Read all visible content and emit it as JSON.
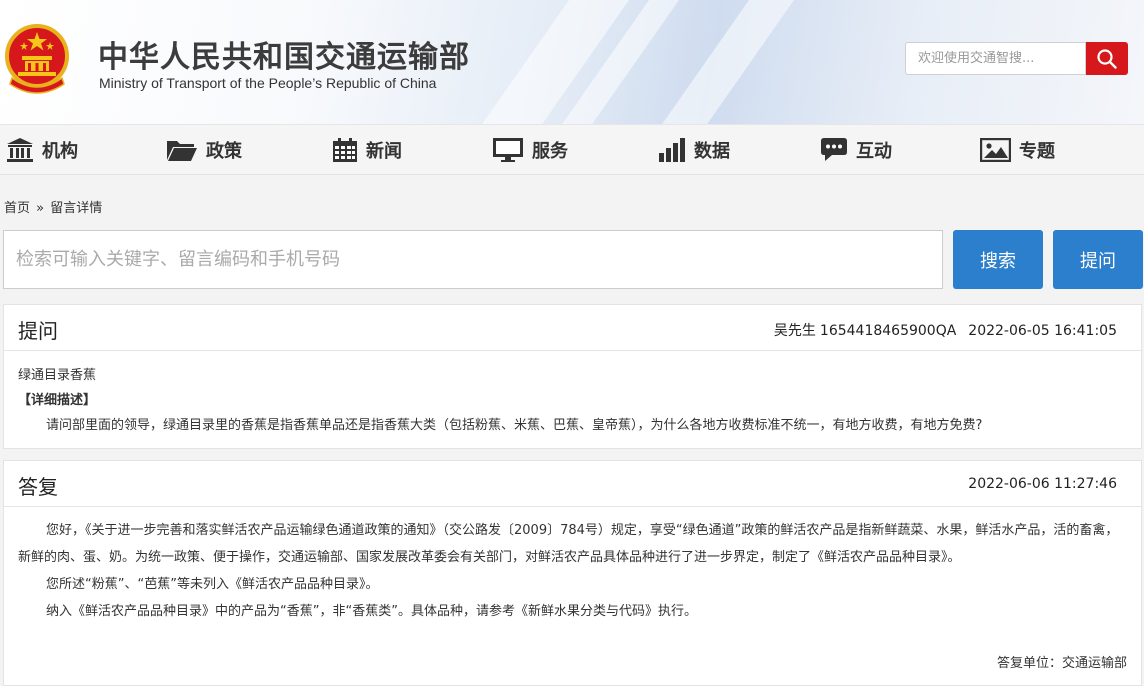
{
  "header": {
    "title": "中华人民共和国交通运输部",
    "subtitle": "Ministry of Transport of the People’s Republic of China",
    "search_placeholder": "欢迎使用交通智搜...",
    "brand_red": "#d6171b"
  },
  "nav": {
    "items": [
      {
        "label": "机构",
        "icon": "building-icon"
      },
      {
        "label": "政策",
        "icon": "folder-icon"
      },
      {
        "label": "新闻",
        "icon": "calendar-icon"
      },
      {
        "label": "服务",
        "icon": "monitor-icon"
      },
      {
        "label": "数据",
        "icon": "bar-chart-icon"
      },
      {
        "label": "互动",
        "icon": "chat-icon"
      },
      {
        "label": "专题",
        "icon": "image-icon"
      }
    ]
  },
  "breadcrumb": {
    "home": "首页",
    "separator": "»",
    "current": "留言详情"
  },
  "query": {
    "placeholder": "检索可输入关键字、留言编码和手机号码",
    "search_label": "搜索",
    "ask_label": "提问",
    "accent": "#2c7fcc"
  },
  "question": {
    "heading": "提问",
    "asker": "吴先生",
    "code": "1654418465900QA",
    "time": "2022-06-05 16:41:05",
    "subject": "绿通目录香蕉",
    "detail_label": "【详细描述】",
    "detail": "请问部里面的领导，绿通目录里的香蕉是指香蕉单品还是指香蕉大类（包括粉蕉、米蕉、巴蕉、皇帝蕉），为什么各地方收费标准不统一，有地方收费，有地方免费?"
  },
  "answer": {
    "heading": "答复",
    "time": "2022-06-06 11:27:46",
    "paragraphs": [
      "您好，《关于进一步完善和落实鲜活农产品运输绿色通道政策的通知》（交公路发〔2009〕784号）规定，享受“绿色通道”政策的鲜活农产品是指新鲜蔬菜、水果，鲜活水产品，活的畜禽，新鲜的肉、蛋、奶。为统一政策、便于操作，交通运输部、国家发展改革委会有关部门，对鲜活农产品具体品种进行了进一步界定，制定了《鲜活农产品品种目录》。",
      "您所述“粉蕉”、“芭蕉”等未列入《鲜活农产品品种目录》。",
      "纳入《鲜活农产品品种目录》中的产品为“香蕉”，非“香蕉类”。具体品种，请参考《新鲜水果分类与代码》执行。"
    ],
    "unit": "答复单位：交通运输部"
  }
}
